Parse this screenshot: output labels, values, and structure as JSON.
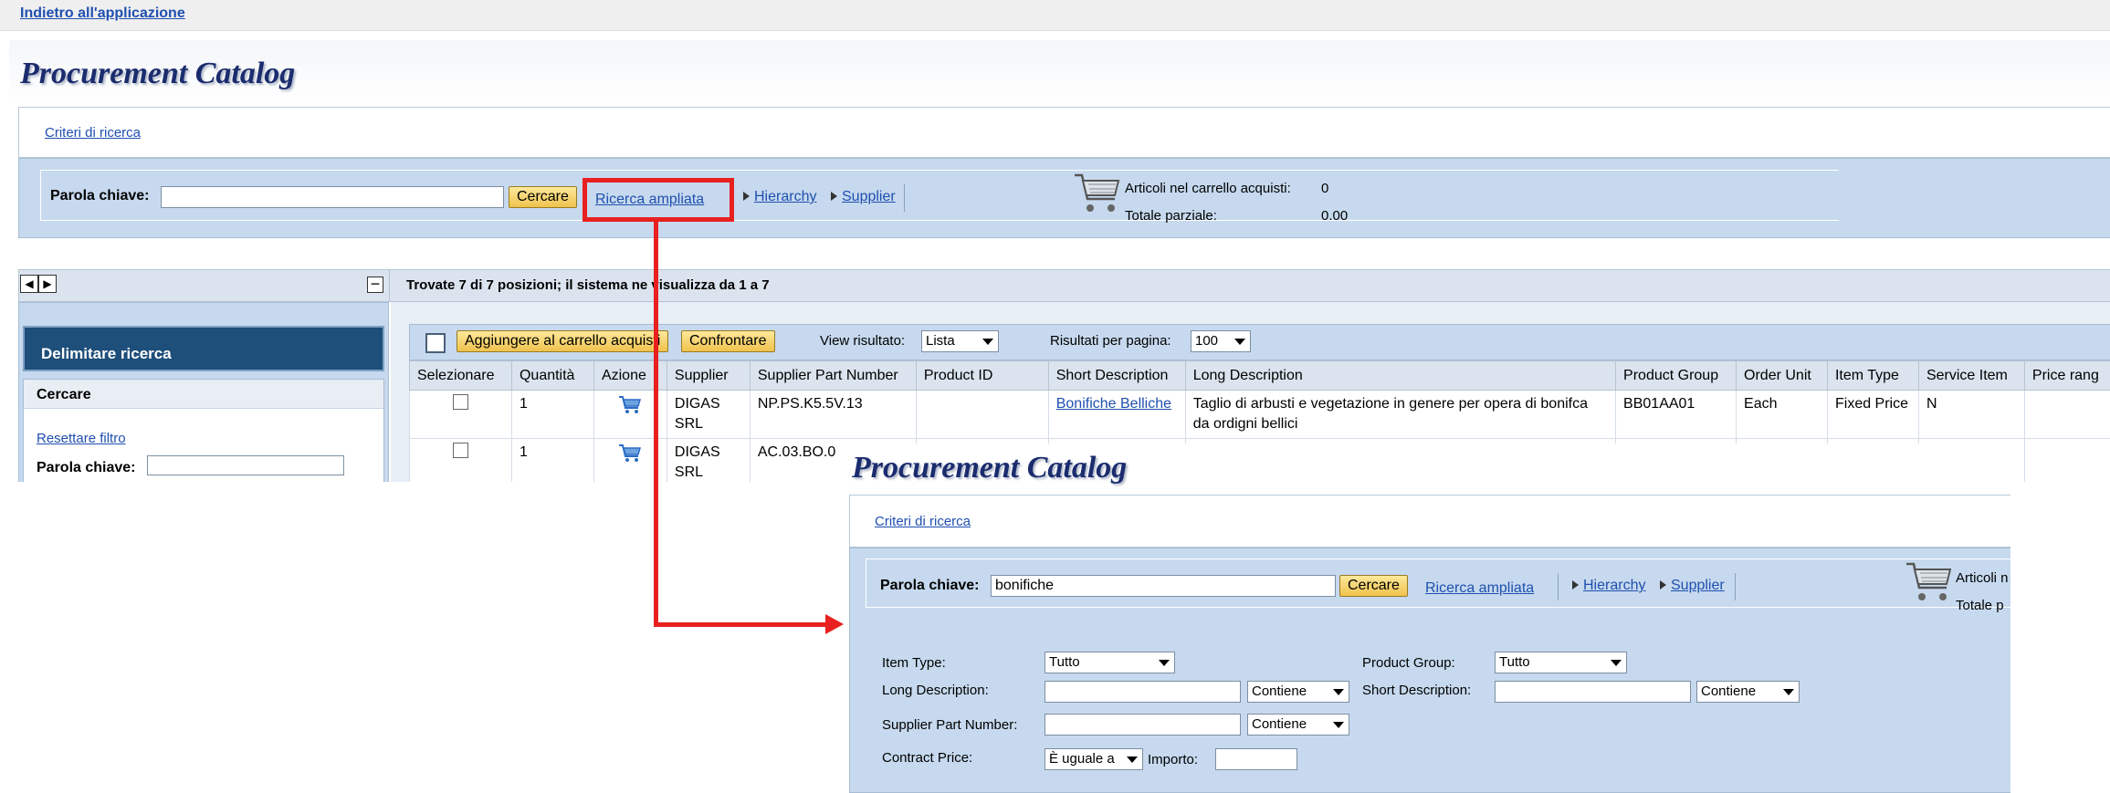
{
  "top_link": "Indietro all'applicazione",
  "main": {
    "title": "Procurement Catalog",
    "search_criteria_link": "Criteri di ricerca",
    "keyword_label": "Parola chiave:",
    "keyword_value": "",
    "search_button": "Cercare",
    "advanced_search_link": "Ricerca ampliata",
    "hierarchy_link": "Hierarchy",
    "supplier_link": "Supplier",
    "cart_items_label": "Articoli nel carrello acquisti:",
    "cart_items_value": "0",
    "subtotal_label": "Totale parziale:",
    "subtotal_value": "0.00"
  },
  "left_panel": {
    "header": "Delimitare ricerca",
    "search_label": "Cercare",
    "reset_filter": "Resettare filtro",
    "keyword_label": "Parola chiave:"
  },
  "results": {
    "summary": "Trovate 7 di 7 posizioni; il sistema ne visualizza da 1 a 7",
    "add_to_cart": "Aggiungere al carrello acquisti",
    "compare": "Confrontare",
    "view_label": "View risultato:",
    "view_value": "Lista",
    "per_page_label": "Risultati per pagina:",
    "per_page_value": "100",
    "columns": [
      "Selezionare",
      "Quantità",
      "Azione",
      "Supplier",
      "Supplier Part Number",
      "Product ID",
      "Short Description",
      "Long Description",
      "Product Group",
      "Order Unit",
      "Item Type",
      "Service Item",
      "Price rang"
    ],
    "rows": [
      {
        "qty": "1",
        "supplier": "DIGAS SRL",
        "part": "NP.PS.K5.5V.13",
        "product_id": "",
        "short": "Bonifiche Belliche",
        "long": "Taglio di arbusti e vegetazione in genere per opera di bonifca da ordigni bellici",
        "group": "BB01AA01",
        "unit": "Each",
        "type": "Fixed Price",
        "service": "N",
        "price": ""
      },
      {
        "qty": "1",
        "supplier": "DIGAS SRL",
        "part": "AC.03.BO.0",
        "product_id": "",
        "short": "",
        "long": "",
        "group": "",
        "unit": "",
        "type": "",
        "service": "",
        "price": ""
      }
    ]
  },
  "zoom": {
    "title": "Procurement Catalog",
    "search_criteria_link": "Criteri di ricerca",
    "keyword_label": "Parola chiave:",
    "keyword_value": "bonifiche",
    "search_button": "Cercare",
    "advanced_search_link": "Ricerca ampliata",
    "hierarchy_link": "Hierarchy",
    "supplier_link": "Supplier",
    "cart_items_label": "Articoli n",
    "subtotal_label": "Totale p",
    "item_type_label": "Item Type:",
    "item_type_value": "Tutto",
    "product_group_label": "Product Group:",
    "product_group_value": "Tutto",
    "long_desc_label": "Long Description:",
    "long_desc_op": "Contiene",
    "short_desc_label": "Short Description:",
    "short_desc_op": "Contiene",
    "supplier_part_label": "Supplier Part Number:",
    "supplier_part_op": "Contiene",
    "contract_price_label": "Contract Price:",
    "contract_price_op": "È uguale a",
    "amount_label": "Importo:"
  },
  "colors": {
    "highlight": "#e8201f",
    "panel_bg": "#c6d9ee",
    "dark_header": "#1e4e7a",
    "link": "#1f4fb0"
  }
}
